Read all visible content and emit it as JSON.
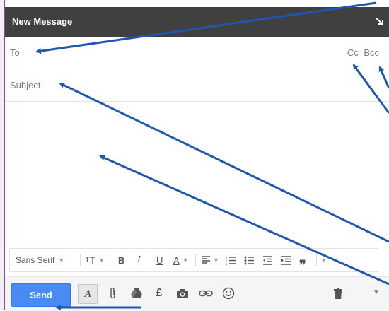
{
  "window": {
    "title": "New Message"
  },
  "to": {
    "label": "To",
    "cc": "Cc",
    "bcc": "Bcc"
  },
  "subject": {
    "placeholder": "Subject"
  },
  "format_bar": {
    "font": "Sans Serif",
    "size_icon": "text-size-icon",
    "bold": "B",
    "italic": "I",
    "underline": "U",
    "text_color": "A",
    "align_icon": "align-icon",
    "numbered_list_icon": "numbered-list-icon",
    "bulleted_list_icon": "bulleted-list-icon",
    "indent_less_icon": "indent-less-icon",
    "indent_more_icon": "indent-more-icon",
    "quote_icon": "quote-icon"
  },
  "bottom_bar": {
    "send_label": "Send",
    "format_toggle": "A",
    "icons": [
      "attach-icon",
      "drive-icon",
      "money-icon",
      "photo-icon",
      "link-icon",
      "emoji-icon",
      "trash-icon",
      "more-options-icon"
    ]
  },
  "colors": {
    "titlebar": "#404040",
    "send": "#4a8af4",
    "annotation_arrow": "#1f56b0"
  }
}
